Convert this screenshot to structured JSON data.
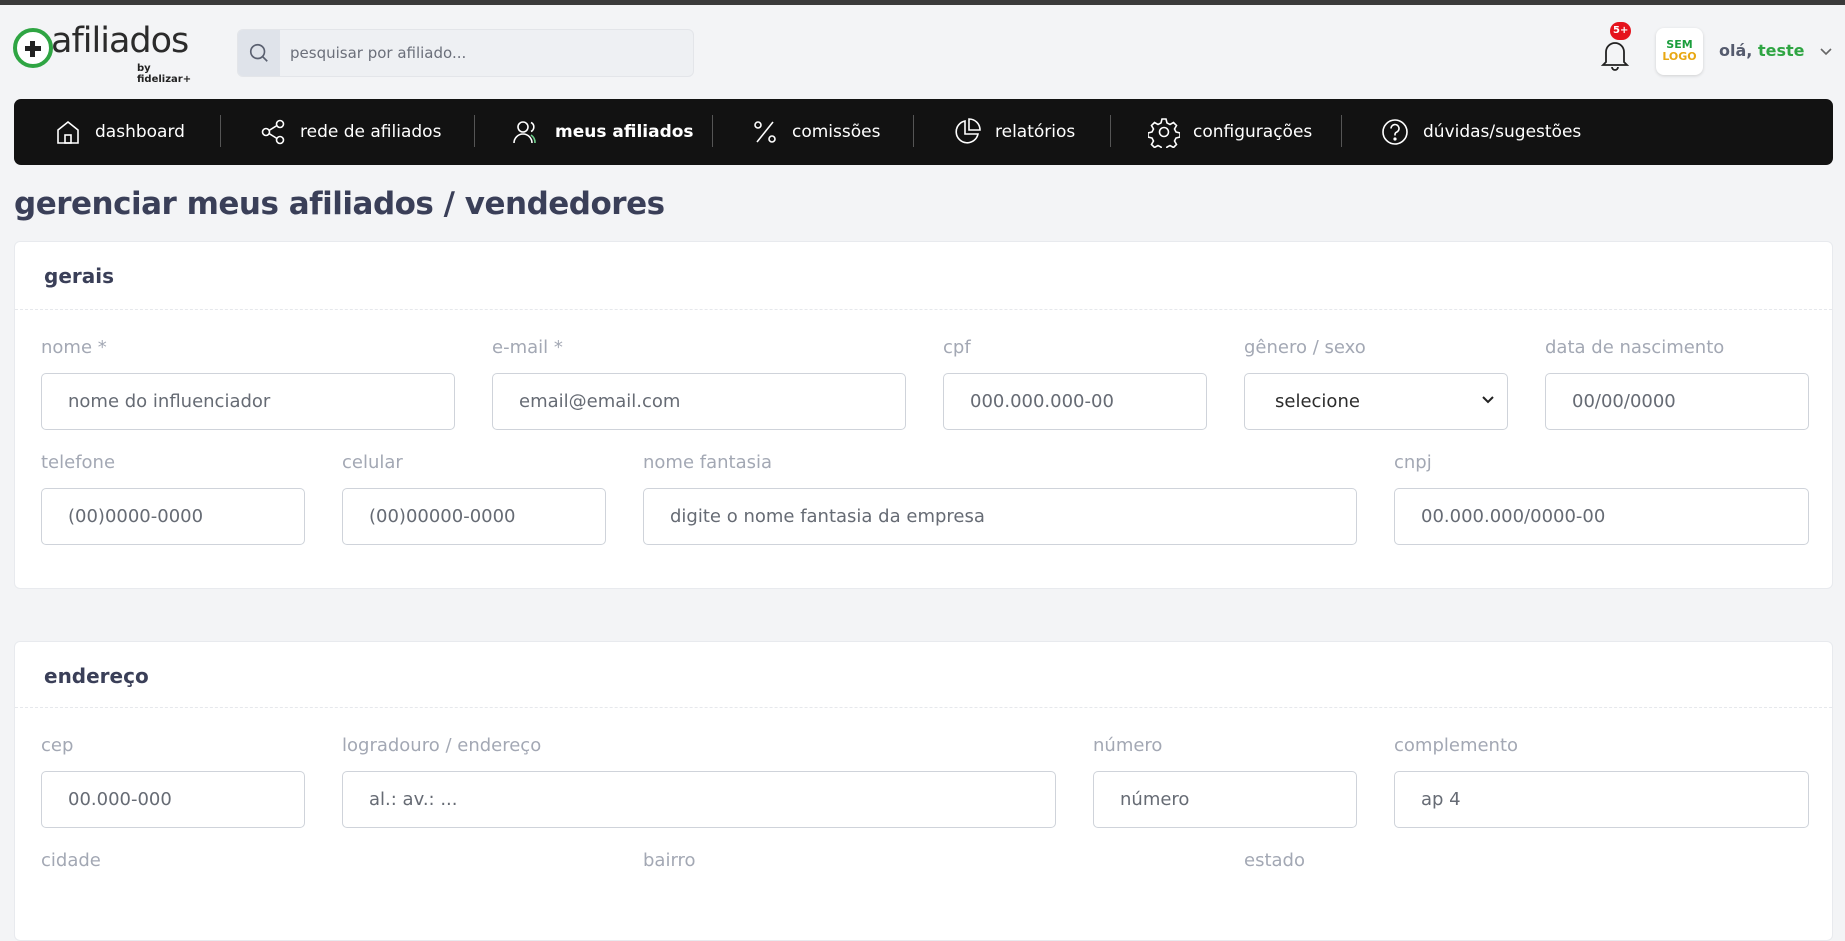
{
  "logo": {
    "word": "afiliados",
    "by": "by fidelizar+"
  },
  "search": {
    "placeholder": "pesquisar por afiliado..."
  },
  "notifications": {
    "badge": "5+"
  },
  "avatar": {
    "line1": "SEM",
    "line2": "LOGO"
  },
  "user": {
    "greeting": "olá,",
    "name": "teste"
  },
  "nav": {
    "items": [
      {
        "label": "dashboard",
        "icon": "home-icon"
      },
      {
        "label": "rede de afiliados",
        "icon": "share-icon"
      },
      {
        "label": "meus afiliados",
        "icon": "users-icon",
        "active": true
      },
      {
        "label": "comissões",
        "icon": "percent-icon"
      },
      {
        "label": "relatórios",
        "icon": "pie-chart-icon"
      },
      {
        "label": "configurações",
        "icon": "gear-icon"
      },
      {
        "label": "dúvidas/sugestões",
        "icon": "help-icon"
      }
    ]
  },
  "page": {
    "title": "gerenciar meus afiliados / vendedores"
  },
  "gerais": {
    "title": "gerais",
    "nome": {
      "label": "nome *",
      "placeholder": "nome do influenciador"
    },
    "email": {
      "label": "e-mail *",
      "placeholder": "email@email.com"
    },
    "cpf": {
      "label": "cpf",
      "placeholder": "000.000.000-00"
    },
    "genero": {
      "label": "gênero / sexo",
      "value": "selecione"
    },
    "nascimento": {
      "label": "data de nascimento",
      "placeholder": "00/00/0000"
    },
    "telefone": {
      "label": "telefone",
      "placeholder": "(00)0000-0000"
    },
    "celular": {
      "label": "celular",
      "placeholder": "(00)00000-0000"
    },
    "fantasia": {
      "label": "nome fantasia",
      "placeholder": "digite o nome fantasia da empresa"
    },
    "cnpj": {
      "label": "cnpj",
      "placeholder": "00.000.000/0000-00"
    }
  },
  "endereco": {
    "title": "endereço",
    "cep": {
      "label": "cep",
      "placeholder": "00.000-000"
    },
    "logradouro": {
      "label": "logradouro / endereço",
      "placeholder": "al.: av.: ..."
    },
    "numero": {
      "label": "número",
      "placeholder": "número"
    },
    "complemento": {
      "label": "complemento",
      "placeholder": "ap 4"
    },
    "cidade": {
      "label": "cidade"
    },
    "bairro": {
      "label": "bairro"
    },
    "estado": {
      "label": "estado"
    }
  },
  "colors": {
    "brand_green": "#2fa543",
    "nav_bg": "#121212",
    "badge_red": "#e5131d"
  }
}
